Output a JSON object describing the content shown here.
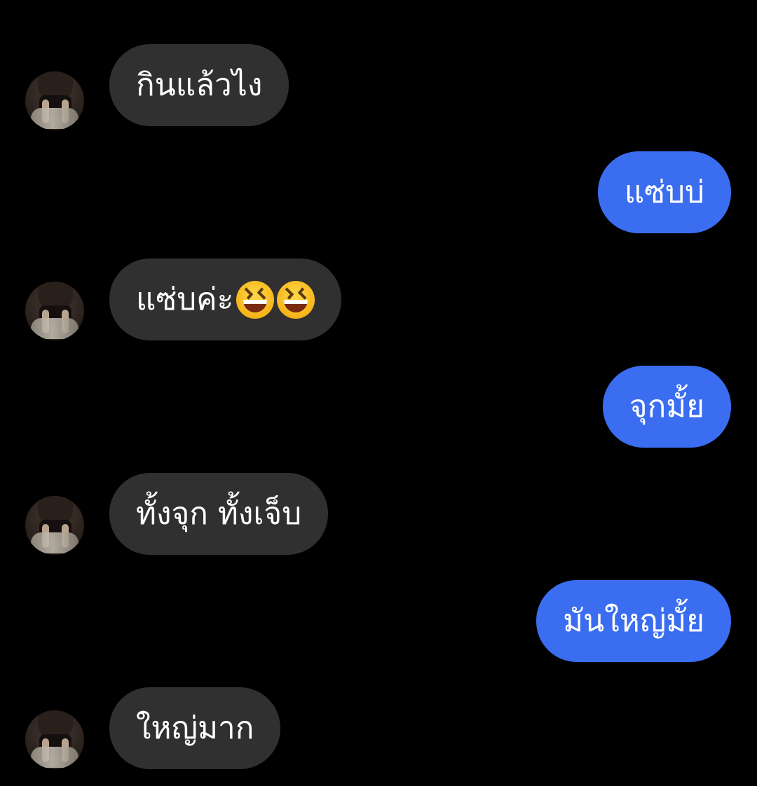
{
  "messages": [
    {
      "side": "incoming",
      "text": "กินแล้วไง"
    },
    {
      "side": "outgoing",
      "text": "แซ่บบ่"
    },
    {
      "side": "incoming",
      "text": "แซ่บค่ะ",
      "emoji": [
        "grinning-squinting-face",
        "grinning-squinting-face"
      ]
    },
    {
      "side": "outgoing",
      "text": "จุกมั้ย"
    },
    {
      "side": "incoming",
      "text": "ทั้งจุก ทั้งเจ็บ"
    },
    {
      "side": "outgoing",
      "text": "มันใหญ่มั้ย"
    },
    {
      "side": "incoming",
      "text": "ใหญ่มาก"
    }
  ],
  "colors": {
    "background": "#000000",
    "incoming_bubble": "#303030",
    "outgoing_bubble": "#3a6df0",
    "text": "#ffffff"
  }
}
